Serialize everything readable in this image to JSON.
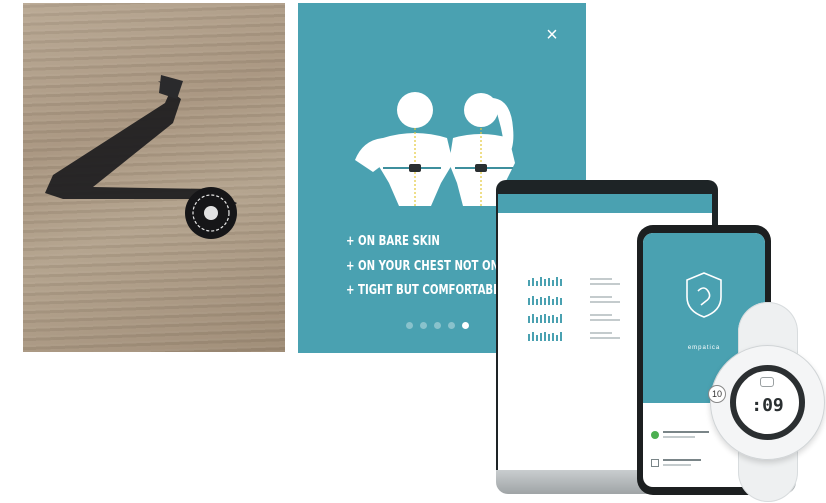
{
  "tutorial": {
    "close_label": "×",
    "tips": [
      "+ ON BARE SKIN",
      "+ ON YOUR CHEST NOT ON YOUR BE",
      "+ TIGHT BUT COMFORTABLE"
    ],
    "pagination": {
      "count": 5,
      "active_index": 4
    }
  },
  "phone": {
    "app_name": "empatica"
  },
  "watch": {
    "time": ":09",
    "button_label": "10"
  },
  "colors": {
    "teal": "#4aa1b1",
    "device_dark": "#1e2426"
  }
}
